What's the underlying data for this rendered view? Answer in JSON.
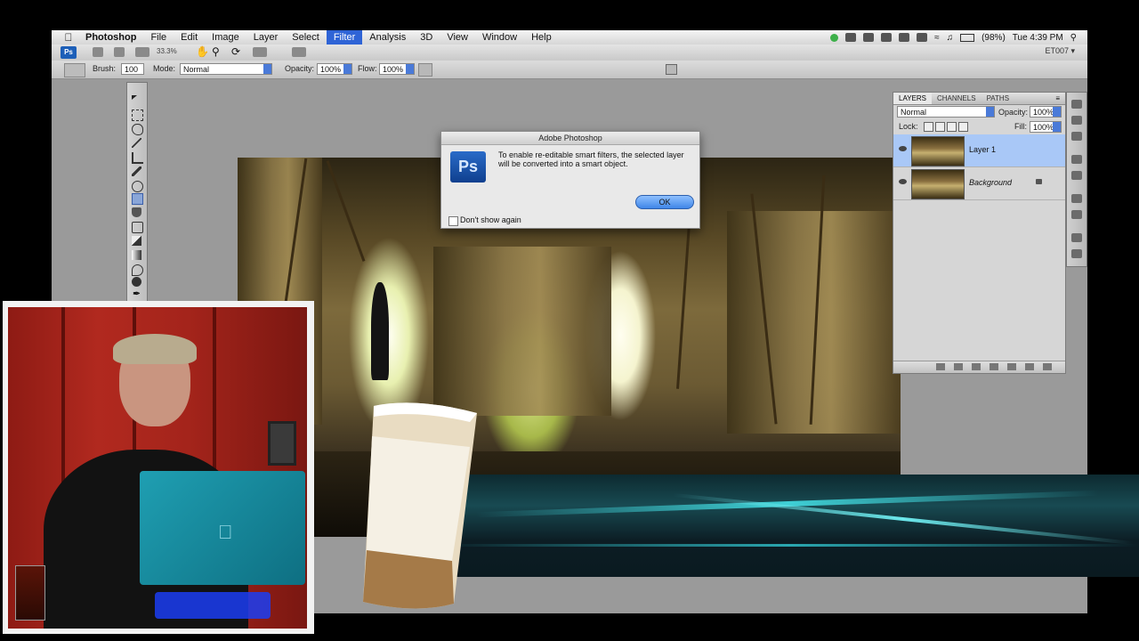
{
  "menubar": {
    "items": [
      {
        "label": "Photoshop",
        "app": true
      },
      {
        "label": "File"
      },
      {
        "label": "Edit"
      },
      {
        "label": "Image"
      },
      {
        "label": "Layer"
      },
      {
        "label": "Select"
      },
      {
        "label": "Filter",
        "active": true
      },
      {
        "label": "Analysis"
      },
      {
        "label": "3D"
      },
      {
        "label": "View"
      },
      {
        "label": "Window"
      },
      {
        "label": "Help"
      }
    ],
    "battery": "(98%)",
    "clock": "Tue 4:39 PM"
  },
  "appbar": {
    "badge": "Ps",
    "zoom": "33.3%",
    "workspace": "ET007 ▾"
  },
  "options": {
    "brush_label": "Brush:",
    "brush_size": "100",
    "mode_label": "Mode:",
    "mode_value": "Normal",
    "opacity_label": "Opacity:",
    "opacity_value": "100%",
    "flow_label": "Flow:",
    "flow_value": "100%"
  },
  "dialog": {
    "title": "Adobe Photoshop",
    "logo": "Ps",
    "message": "To enable re-editable smart filters, the selected layer will be converted into a smart object.",
    "ok_label": "OK",
    "checkbox_label": "Don't show again",
    "checkbox_checked": false
  },
  "layers_panel": {
    "tabs": [
      "LAYERS",
      "CHANNELS",
      "PATHS"
    ],
    "active_tab": "LAYERS",
    "blend_mode": "Normal",
    "opacity_label": "Opacity:",
    "opacity_value": "100%",
    "lock_label": "Lock:",
    "fill_label": "Fill:",
    "fill_value": "100%",
    "layers": [
      {
        "name": "Layer 1",
        "selected": true,
        "visible": true
      },
      {
        "name": "Background",
        "selected": false,
        "visible": true,
        "locked": true
      }
    ]
  },
  "colors": {
    "menu_highlight": "#2f64d6",
    "layer_selected": "#a9c8f7",
    "banner_teal": "#3fd0d6"
  }
}
